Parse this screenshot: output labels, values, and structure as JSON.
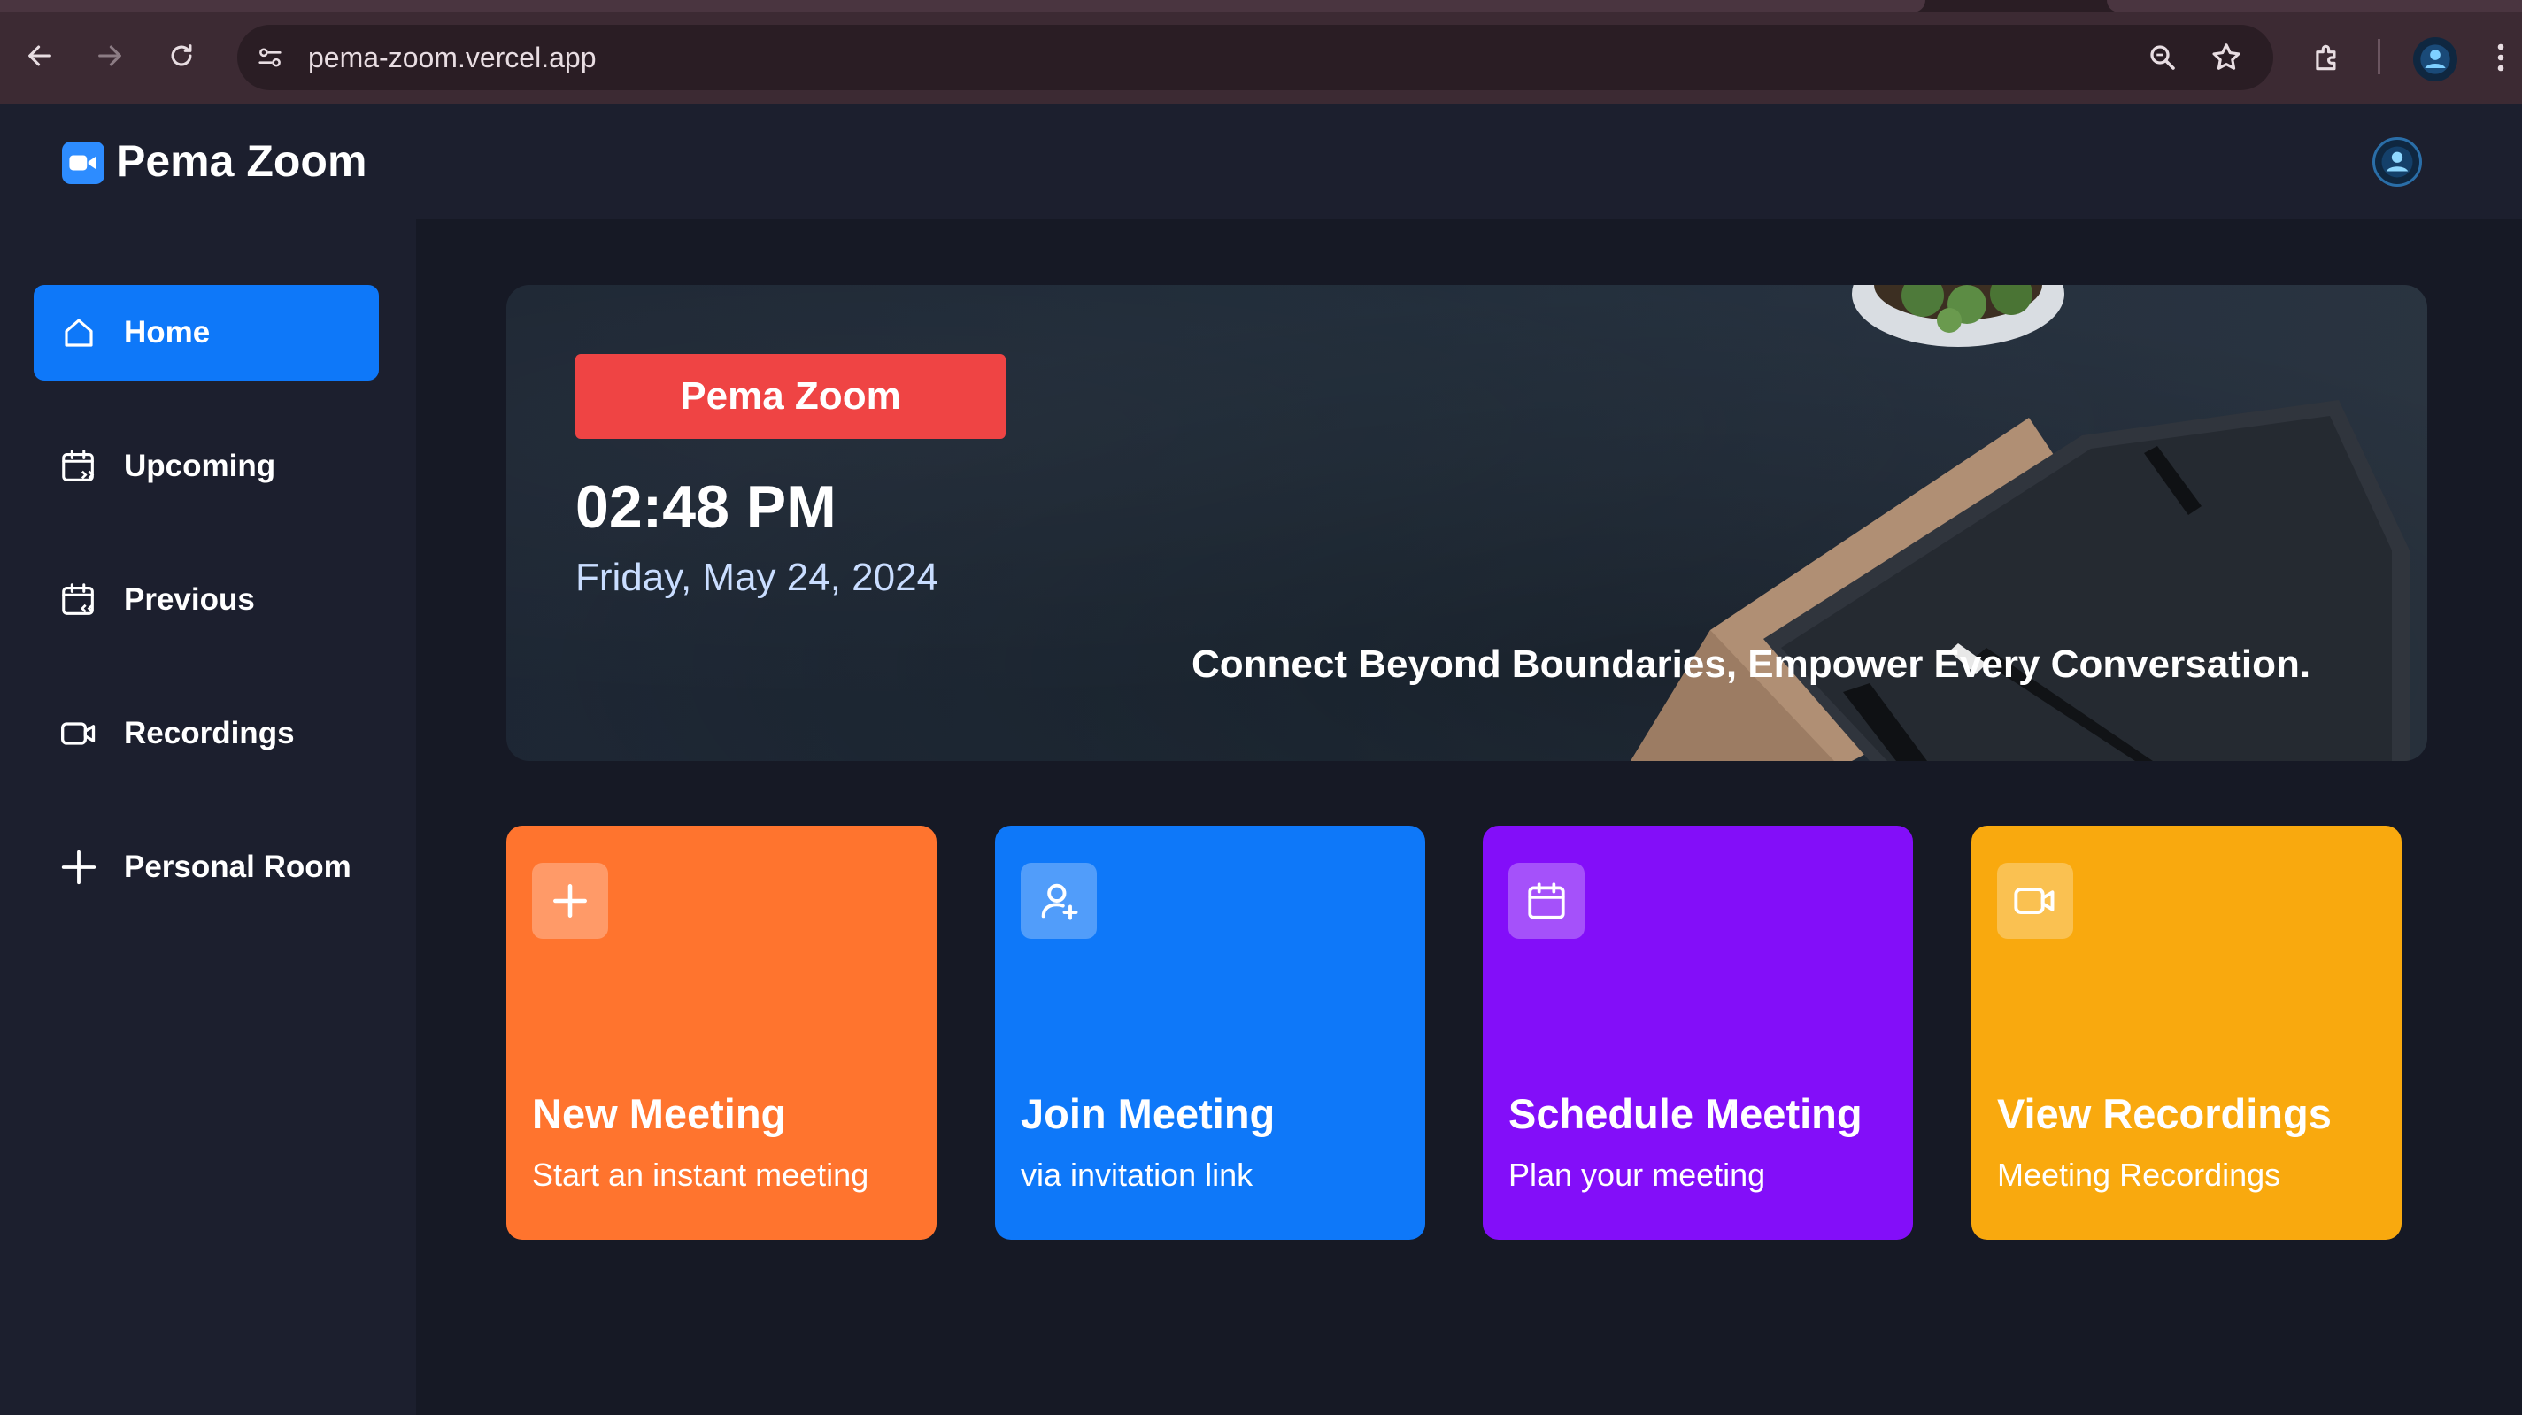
{
  "browser": {
    "url": "pema-zoom.vercel.app"
  },
  "app": {
    "name": "Pema Zoom"
  },
  "sidebar": {
    "items": [
      {
        "label": "Home",
        "icon": "home-icon",
        "active": true
      },
      {
        "label": "Upcoming",
        "icon": "calendar-upcoming-icon",
        "active": false
      },
      {
        "label": "Previous",
        "icon": "calendar-previous-icon",
        "active": false
      },
      {
        "label": "Recordings",
        "icon": "video-icon",
        "active": false
      },
      {
        "label": "Personal Room",
        "icon": "plus-icon",
        "active": false
      }
    ]
  },
  "hero": {
    "badge": "Pema Zoom",
    "time": "02:48 PM",
    "date": "Friday, May 24, 2024",
    "tagline": "Connect Beyond Boundaries, Empower Every Conversation."
  },
  "cards": [
    {
      "title": "New Meeting",
      "subtitle": "Start an instant meeting",
      "icon": "plus-icon",
      "color": "#ff742e"
    },
    {
      "title": "Join Meeting",
      "subtitle": "via invitation link",
      "icon": "user-add-icon",
      "color": "#0e78f9"
    },
    {
      "title": "Schedule Meeting",
      "subtitle": "Plan your meeting",
      "icon": "calendar-icon",
      "color": "#830ef9"
    },
    {
      "title": "View Recordings",
      "subtitle": "Meeting Recordings",
      "icon": "video-icon",
      "color": "#f9a90e"
    }
  ],
  "colors": {
    "background": "#161925",
    "sidebar": "#1c1f2e",
    "accent": "#0e78f9",
    "badge": "#ef4444"
  }
}
